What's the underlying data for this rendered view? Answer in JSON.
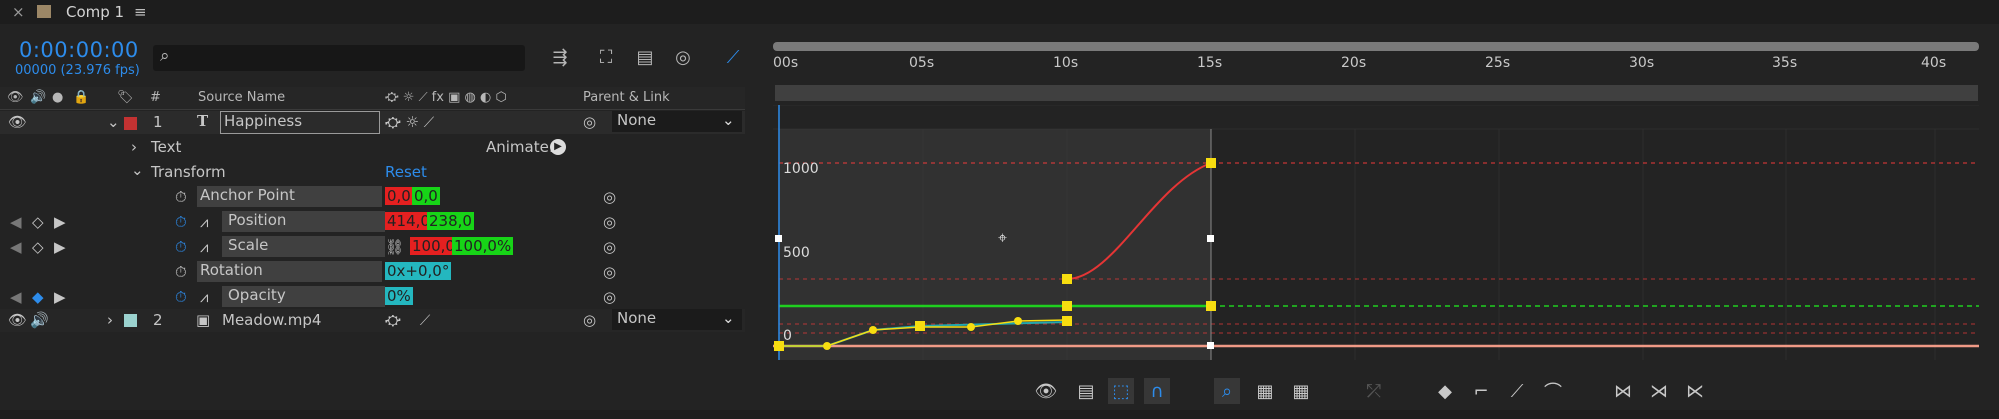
{
  "tab": {
    "close": "×",
    "title": "Comp 1",
    "menu": "≡"
  },
  "timecode": "0:00:00:00",
  "frames": "00000 (23.976 fps)",
  "search": {
    "icon": "search-icon",
    "placeholder": ""
  },
  "columns": {
    "source_name": "Source Name",
    "number": "#",
    "parent_link": "Parent & Link"
  },
  "layers": [
    {
      "index": "1",
      "type_glyph": "T",
      "name": "Happiness",
      "parent": "None",
      "label_color": "#c33232"
    },
    {
      "index": "2",
      "name": "Meadow.mp4",
      "parent": "None",
      "label_color": "#9bd2cf"
    }
  ],
  "properties": {
    "text": "Text",
    "animate": "Animate:",
    "transform": "Transform",
    "reset": "Reset",
    "anchor_point": {
      "label": "Anchor Point",
      "v1": "0,0",
      "v2": "0,0"
    },
    "position": {
      "label": "Position",
      "v1": "414,0",
      "v2": "238,0"
    },
    "scale": {
      "label": "Scale",
      "v1": "100,0",
      "v2": "100,0%"
    },
    "rotation": {
      "label": "Rotation",
      "v1": "0x+0,0°"
    },
    "opacity": {
      "label": "Opacity",
      "v1": "0%"
    }
  },
  "ruler": [
    "00s",
    "05s",
    "10s",
    "15s",
    "20s",
    "25s",
    "30s",
    "35s",
    "40s"
  ],
  "graph_labels": [
    "1000",
    "500",
    "0"
  ],
  "colors": {
    "accent": "#2d8ceb",
    "keyframe": "#f7dd10",
    "position_curve": "#e53535",
    "scale_curve": "#1fcf1f",
    "opacity_curve": "#23a7ad"
  }
}
